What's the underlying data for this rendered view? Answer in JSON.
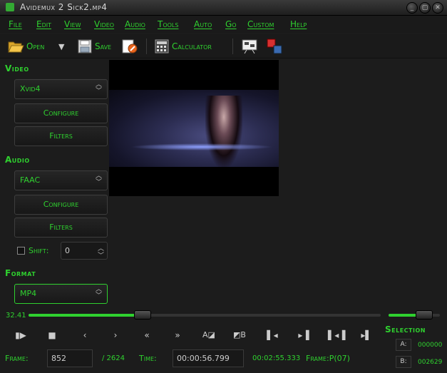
{
  "window": {
    "title": "Avidemux 2 Sick2.mp4",
    "controls": [
      "_",
      "▢",
      "✕"
    ]
  },
  "menu": [
    "File",
    "Edit",
    "View",
    "Video",
    "Audio",
    "Tools",
    "Auto",
    "Go",
    "Custom",
    "Help"
  ],
  "toolbar": {
    "open": "Open",
    "save": "Save",
    "calculator": "Calculator"
  },
  "video": {
    "heading": "Video",
    "codec": "Xvid4",
    "configure": "Configure",
    "filters": "Filters"
  },
  "audio": {
    "heading": "Audio",
    "codec": "FAAC",
    "configure": "Configure",
    "filters": "Filters",
    "shift_label": "Shift:",
    "shift_value": "0"
  },
  "format": {
    "heading": "Format",
    "container": "MP4"
  },
  "timeline": {
    "percent": "32.41",
    "progress": 0.3241,
    "volume": 0.7
  },
  "navigation": [
    "play",
    "stop",
    "prev-frame",
    "next-frame",
    "rewind",
    "fast-forward",
    "set-marker-a",
    "set-marker-b",
    "prev-keyframe",
    "next-keyframe",
    "go-start",
    "go-end"
  ],
  "status": {
    "frame_label": "Frame:",
    "frame_value": "852",
    "frame_total": "/ 2624",
    "time_label": "Time:",
    "time_value": "00:00:56.799",
    "duration": "00:02:55.333",
    "frame_type": "Frame:P(07)"
  },
  "selection": {
    "heading": "Selection",
    "a_label": "A:",
    "a_value": "000000",
    "b_label": "B:",
    "b_value": "002629"
  },
  "colors": {
    "accent": "#2fd12f",
    "background": "#1c1c1c"
  }
}
